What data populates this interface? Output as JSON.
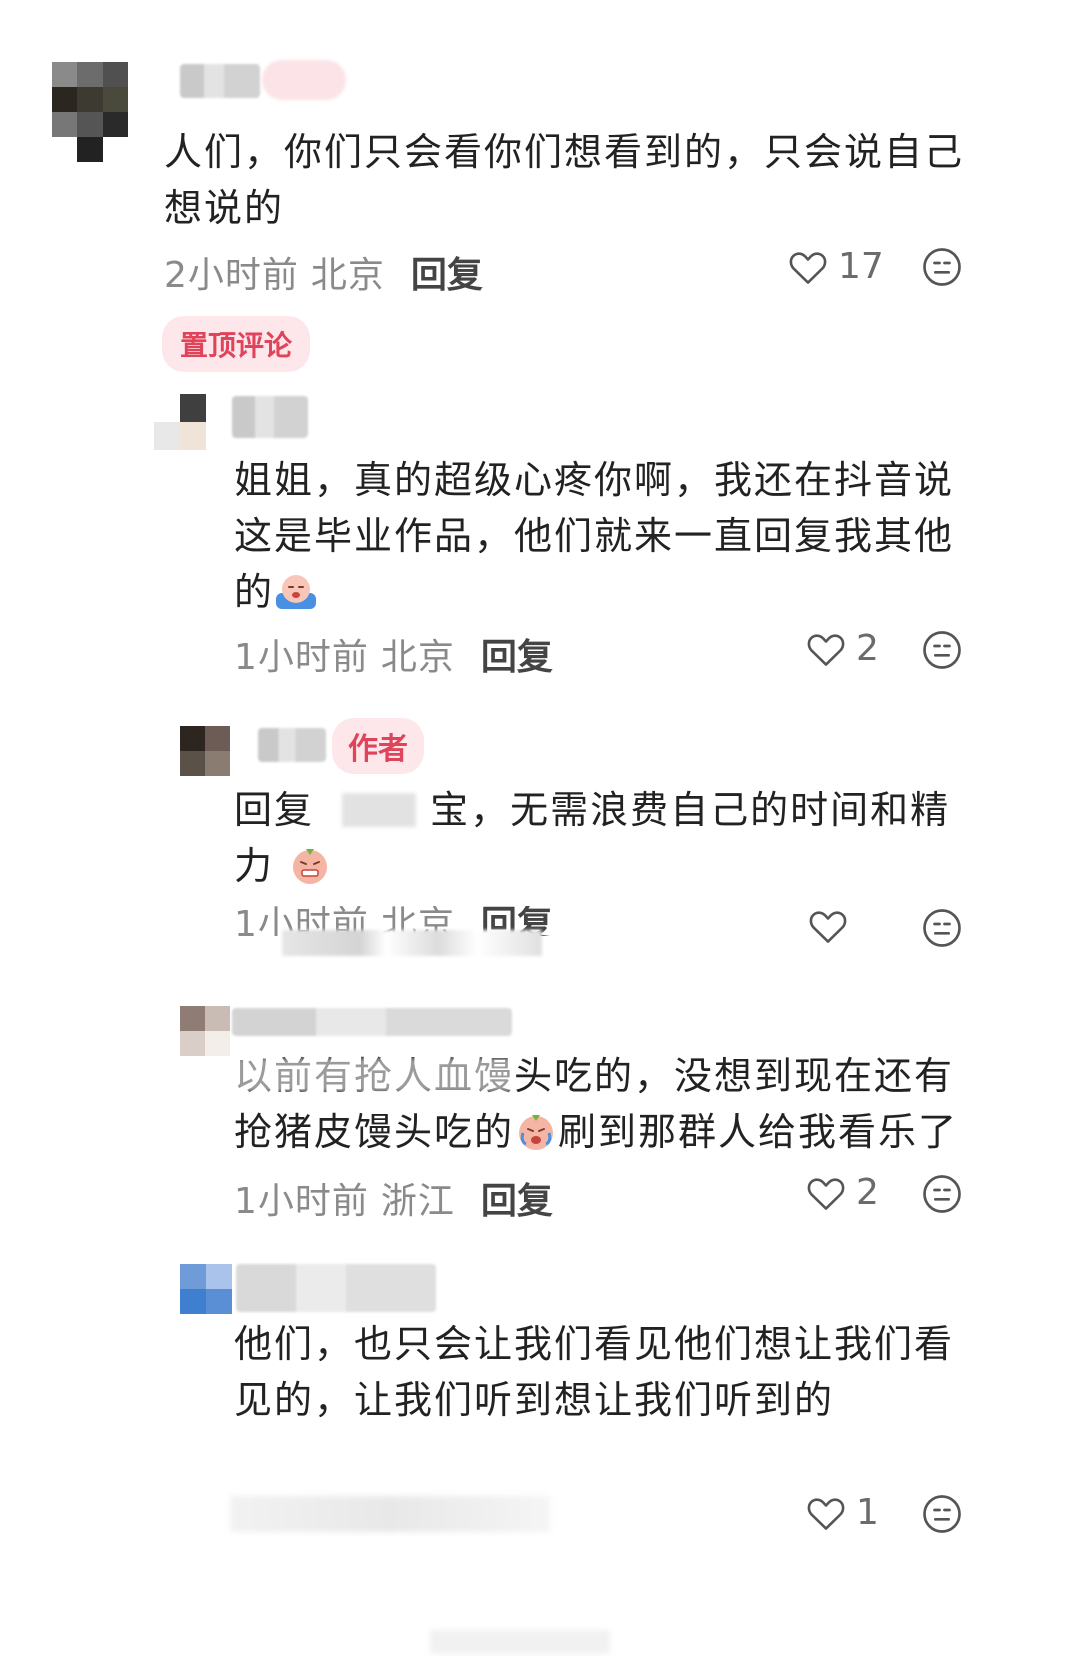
{
  "comments": [
    {
      "text": "人们，你们只会看你们想看到的，只会说自己想说的",
      "time": "2小时前",
      "location": "北京",
      "reply_label": "回复",
      "likes": "17",
      "pinned_label": "置顶评论"
    },
    {
      "text": "姐姐，真的超级心疼你啊，我还在抖音说这是毕业作品，他们就来一直回复我其他的",
      "time": "1小时前",
      "location": "北京",
      "reply_label": "回复",
      "likes": "2"
    },
    {
      "reply_prefix": "回复",
      "text": "宝，无需浪费自己的时间和精力",
      "author_tag": "作者",
      "time": "1小时前",
      "location": "北京",
      "reply_label": "回复",
      "likes": ""
    },
    {
      "text": "以前有抢人血馒头吃的，没想到现在还有抢猪皮馒头吃的",
      "text_after_emoji": "刷到那群人给我看乐了",
      "time": "1小时前",
      "location": "浙江",
      "reply_label": "回复",
      "likes": "2"
    },
    {
      "text": "他们，也只会让我们看见他们想让我们看见的，让我们听到想让我们听到的",
      "likes": "1"
    }
  ],
  "icons": {
    "like": "heart-outline-icon",
    "dislike": "neutral-face-icon"
  },
  "colors": {
    "accent": "#e0445b",
    "tag_bg": "#fde7ea",
    "meta_gray": "#8a8a8a"
  }
}
